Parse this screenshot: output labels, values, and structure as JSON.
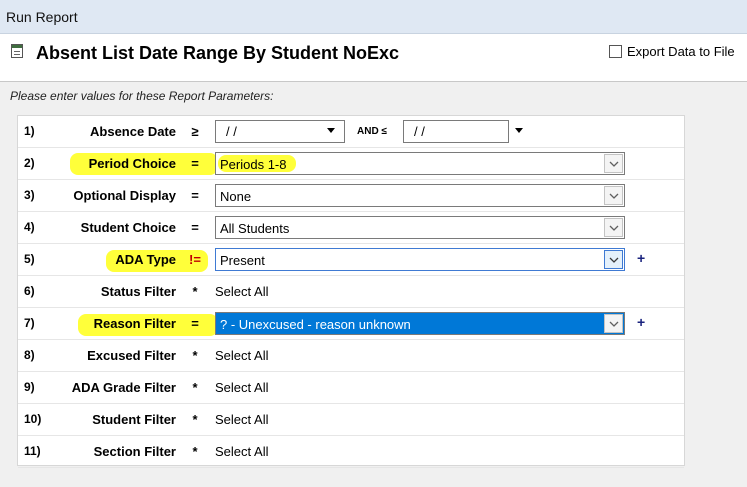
{
  "window": {
    "title": "Run Report"
  },
  "report": {
    "title": "Absent List Date Range By Student NoExc"
  },
  "export": {
    "label": "Export Data to File",
    "checked": false
  },
  "prompt": "Please enter values for these Report Parameters:",
  "params": {
    "absence_date": {
      "num": "1)",
      "label": "Absence Date",
      "op": "≥",
      "from": "/ /",
      "and_label": "AND ≤",
      "to": "/ /"
    },
    "period_choice": {
      "num": "2)",
      "label": "Period Choice",
      "op": "=",
      "value": "Periods 1-8"
    },
    "optional_display": {
      "num": "3)",
      "label": "Optional Display",
      "op": "=",
      "value": "None"
    },
    "student_choice": {
      "num": "4)",
      "label": "Student Choice",
      "op": "=",
      "value": "All Students"
    },
    "ada_type": {
      "num": "5)",
      "label": "ADA Type",
      "op": "!=",
      "value": "Present",
      "plus": "+"
    },
    "status_filter": {
      "num": "6)",
      "label": "Status Filter",
      "op": "*",
      "value": "Select All"
    },
    "reason_filter": {
      "num": "7)",
      "label": "Reason Filter",
      "op": "=",
      "value": "? - Unexcused - reason unknown",
      "plus": "+"
    },
    "excused_filter": {
      "num": "8)",
      "label": "Excused Filter",
      "op": "*",
      "value": "Select All"
    },
    "ada_grade_filter": {
      "num": "9)",
      "label": "ADA Grade Filter",
      "op": "*",
      "value": "Select All"
    },
    "student_filter": {
      "num": "10)",
      "label": "Student Filter",
      "op": "*",
      "value": "Select All"
    },
    "section_filter": {
      "num": "11)",
      "label": "Section Filter",
      "op": "*",
      "value": "Select All"
    }
  },
  "colors": {
    "highlight": "#ffff3a",
    "selection": "#0078d7",
    "not_equal_op": "#c00000",
    "plus": "#1a237e"
  }
}
